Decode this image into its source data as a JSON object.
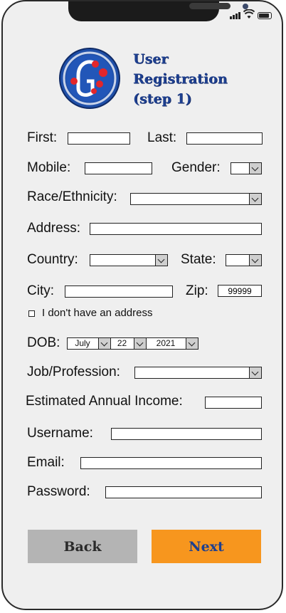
{
  "header": {
    "title_lines": [
      "User",
      "Registration",
      "(step 1)"
    ]
  },
  "form": {
    "first_label": "First:",
    "last_label": "Last:",
    "mobile_label": "Mobile:",
    "gender_label": "Gender:",
    "race_label": "Race/Ethnicity:",
    "address_label": "Address:",
    "country_label": "Country:",
    "state_label": "State:",
    "city_label": "City:",
    "zip_label": "Zip:",
    "zip_value": "99999",
    "no_address_label": "I don't have an address",
    "dob_label": "DOB:",
    "dob_month": "July",
    "dob_day": "22",
    "dob_year": "2021",
    "job_label": "Job/Profession:",
    "income_label": "Estimated Annual Income:",
    "username_label": "Username:",
    "email_label": "Email:",
    "password_label": "Password:"
  },
  "buttons": {
    "back": "Back",
    "next": "Next"
  },
  "colors": {
    "accent": "#f7961e",
    "brand_blue": "#1d3f8f",
    "back_gray": "#b4b4b4"
  }
}
